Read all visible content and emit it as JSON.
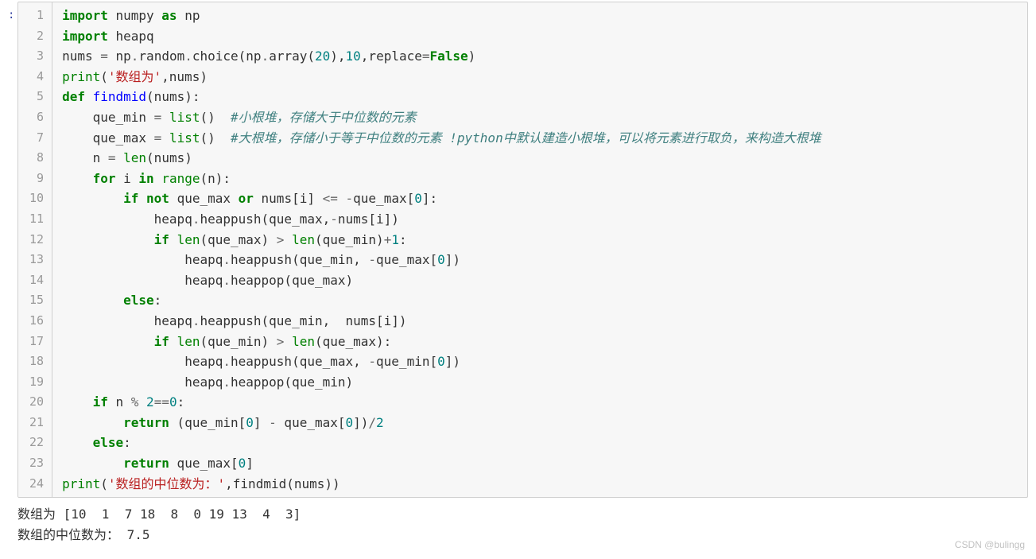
{
  "prompt": ":",
  "lines": [
    {
      "n": "1",
      "tokens": [
        {
          "t": "import",
          "c": "kw"
        },
        {
          "t": " numpy "
        },
        {
          "t": "as",
          "c": "kw"
        },
        {
          "t": " np"
        }
      ]
    },
    {
      "n": "2",
      "tokens": [
        {
          "t": "import",
          "c": "kw"
        },
        {
          "t": " heapq"
        }
      ]
    },
    {
      "n": "3",
      "tokens": [
        {
          "t": "nums "
        },
        {
          "t": "=",
          "c": "op"
        },
        {
          "t": " np"
        },
        {
          "t": ".",
          "c": "op"
        },
        {
          "t": "random"
        },
        {
          "t": ".",
          "c": "op"
        },
        {
          "t": "choice(np"
        },
        {
          "t": ".",
          "c": "op"
        },
        {
          "t": "array("
        },
        {
          "t": "20",
          "c": "num"
        },
        {
          "t": "),"
        },
        {
          "t": "10",
          "c": "num"
        },
        {
          "t": ",replace"
        },
        {
          "t": "=",
          "c": "op"
        },
        {
          "t": "False",
          "c": "kw"
        },
        {
          "t": ")"
        }
      ]
    },
    {
      "n": "4",
      "tokens": [
        {
          "t": "print",
          "c": "bi"
        },
        {
          "t": "("
        },
        {
          "t": "'数组为'",
          "c": "str"
        },
        {
          "t": ",nums)"
        }
      ]
    },
    {
      "n": "5",
      "tokens": [
        {
          "t": "def",
          "c": "kw"
        },
        {
          "t": " "
        },
        {
          "t": "findmid",
          "c": "fn"
        },
        {
          "t": "(nums):"
        }
      ]
    },
    {
      "n": "6",
      "tokens": [
        {
          "t": "    que_min "
        },
        {
          "t": "=",
          "c": "op"
        },
        {
          "t": " "
        },
        {
          "t": "list",
          "c": "bi"
        },
        {
          "t": "()  "
        },
        {
          "t": "#小根堆，存储大于中位数的元素",
          "c": "cm"
        }
      ]
    },
    {
      "n": "7",
      "tokens": [
        {
          "t": "    que_max "
        },
        {
          "t": "=",
          "c": "op"
        },
        {
          "t": " "
        },
        {
          "t": "list",
          "c": "bi"
        },
        {
          "t": "()  "
        },
        {
          "t": "#大根堆，存储小于等于中位数的元素 !python中默认建造小根堆，可以将元素进行取负，来构造大根堆",
          "c": "cm"
        }
      ]
    },
    {
      "n": "8",
      "tokens": [
        {
          "t": "    n "
        },
        {
          "t": "=",
          "c": "op"
        },
        {
          "t": " "
        },
        {
          "t": "len",
          "c": "bi"
        },
        {
          "t": "(nums)"
        }
      ]
    },
    {
      "n": "9",
      "tokens": [
        {
          "t": "    "
        },
        {
          "t": "for",
          "c": "kw"
        },
        {
          "t": " i "
        },
        {
          "t": "in",
          "c": "kw"
        },
        {
          "t": " "
        },
        {
          "t": "range",
          "c": "bi"
        },
        {
          "t": "(n):"
        }
      ]
    },
    {
      "n": "10",
      "tokens": [
        {
          "t": "        "
        },
        {
          "t": "if",
          "c": "kw"
        },
        {
          "t": " "
        },
        {
          "t": "not",
          "c": "kw"
        },
        {
          "t": " que_max "
        },
        {
          "t": "or",
          "c": "kw"
        },
        {
          "t": " nums[i] "
        },
        {
          "t": "<=",
          "c": "op"
        },
        {
          "t": " "
        },
        {
          "t": "-",
          "c": "op"
        },
        {
          "t": "que_max["
        },
        {
          "t": "0",
          "c": "num"
        },
        {
          "t": "]:"
        }
      ]
    },
    {
      "n": "11",
      "tokens": [
        {
          "t": "            heapq"
        },
        {
          "t": ".",
          "c": "op"
        },
        {
          "t": "heappush(que_max,"
        },
        {
          "t": "-",
          "c": "op"
        },
        {
          "t": "nums[i])"
        }
      ]
    },
    {
      "n": "12",
      "tokens": [
        {
          "t": "            "
        },
        {
          "t": "if",
          "c": "kw"
        },
        {
          "t": " "
        },
        {
          "t": "len",
          "c": "bi"
        },
        {
          "t": "(que_max) "
        },
        {
          "t": ">",
          "c": "op"
        },
        {
          "t": " "
        },
        {
          "t": "len",
          "c": "bi"
        },
        {
          "t": "(que_min)"
        },
        {
          "t": "+",
          "c": "op"
        },
        {
          "t": "1",
          "c": "num"
        },
        {
          "t": ":"
        }
      ]
    },
    {
      "n": "13",
      "tokens": [
        {
          "t": "                heapq"
        },
        {
          "t": ".",
          "c": "op"
        },
        {
          "t": "heappush(que_min, "
        },
        {
          "t": "-",
          "c": "op"
        },
        {
          "t": "que_max["
        },
        {
          "t": "0",
          "c": "num"
        },
        {
          "t": "])"
        }
      ]
    },
    {
      "n": "14",
      "tokens": [
        {
          "t": "                heapq"
        },
        {
          "t": ".",
          "c": "op"
        },
        {
          "t": "heappop(que_max)"
        }
      ]
    },
    {
      "n": "15",
      "tokens": [
        {
          "t": "        "
        },
        {
          "t": "else",
          "c": "kw"
        },
        {
          "t": ":"
        }
      ]
    },
    {
      "n": "16",
      "tokens": [
        {
          "t": "            heapq"
        },
        {
          "t": ".",
          "c": "op"
        },
        {
          "t": "heappush(que_min,  nums[i])"
        }
      ]
    },
    {
      "n": "17",
      "tokens": [
        {
          "t": "            "
        },
        {
          "t": "if",
          "c": "kw"
        },
        {
          "t": " "
        },
        {
          "t": "len",
          "c": "bi"
        },
        {
          "t": "(que_min) "
        },
        {
          "t": ">",
          "c": "op"
        },
        {
          "t": " "
        },
        {
          "t": "len",
          "c": "bi"
        },
        {
          "t": "(que_max):"
        }
      ]
    },
    {
      "n": "18",
      "tokens": [
        {
          "t": "                heapq"
        },
        {
          "t": ".",
          "c": "op"
        },
        {
          "t": "heappush(que_max, "
        },
        {
          "t": "-",
          "c": "op"
        },
        {
          "t": "que_min["
        },
        {
          "t": "0",
          "c": "num"
        },
        {
          "t": "])"
        }
      ]
    },
    {
      "n": "19",
      "tokens": [
        {
          "t": "                heapq"
        },
        {
          "t": ".",
          "c": "op"
        },
        {
          "t": "heappop(que_min)"
        }
      ]
    },
    {
      "n": "20",
      "tokens": [
        {
          "t": "    "
        },
        {
          "t": "if",
          "c": "kw"
        },
        {
          "t": " n "
        },
        {
          "t": "%",
          "c": "op"
        },
        {
          "t": " "
        },
        {
          "t": "2",
          "c": "num"
        },
        {
          "t": "==",
          "c": "op"
        },
        {
          "t": "0",
          "c": "num"
        },
        {
          "t": ":"
        }
      ]
    },
    {
      "n": "21",
      "tokens": [
        {
          "t": "        "
        },
        {
          "t": "return",
          "c": "kw"
        },
        {
          "t": " (que_min["
        },
        {
          "t": "0",
          "c": "num"
        },
        {
          "t": "] "
        },
        {
          "t": "-",
          "c": "op"
        },
        {
          "t": " que_max["
        },
        {
          "t": "0",
          "c": "num"
        },
        {
          "t": "])"
        },
        {
          "t": "/",
          "c": "op"
        },
        {
          "t": "2",
          "c": "num"
        }
      ]
    },
    {
      "n": "22",
      "tokens": [
        {
          "t": "    "
        },
        {
          "t": "else",
          "c": "kw"
        },
        {
          "t": ":"
        }
      ]
    },
    {
      "n": "23",
      "tokens": [
        {
          "t": "        "
        },
        {
          "t": "return",
          "c": "kw"
        },
        {
          "t": " que_max["
        },
        {
          "t": "0",
          "c": "num"
        },
        {
          "t": "]"
        }
      ]
    },
    {
      "n": "24",
      "tokens": [
        {
          "t": "print",
          "c": "bi"
        },
        {
          "t": "("
        },
        {
          "t": "'数组的中位数为：'",
          "c": "str"
        },
        {
          "t": ",findmid(nums))"
        }
      ]
    }
  ],
  "output": {
    "line1": "数组为 [10  1  7 18  8  0 19 13  4  3]",
    "line2": "数组的中位数为： 7.5"
  },
  "watermark": "CSDN @bulingg"
}
